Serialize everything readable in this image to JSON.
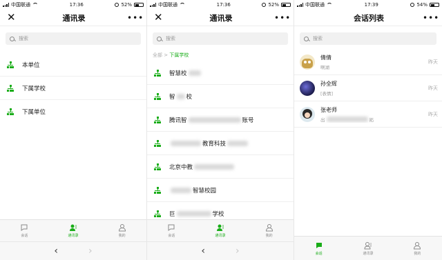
{
  "colors": {
    "accent": "#1aad19"
  },
  "screens": [
    {
      "status": {
        "carrier": "中国联通",
        "time": "17:36",
        "battery": "52%"
      },
      "nav": {
        "title": "通讯录",
        "close_icon": "close-icon",
        "more": "•••"
      },
      "search": {
        "placeholder": "搜索"
      },
      "orgs": [
        {
          "label": "本单位"
        },
        {
          "label": "下属学校"
        },
        {
          "label": "下属单位"
        }
      ],
      "tabs": [
        {
          "label": "会话"
        },
        {
          "label": "通讯录"
        },
        {
          "label": "我的"
        }
      ]
    },
    {
      "status": {
        "carrier": "中国联通",
        "time": "17:36",
        "battery": "52%"
      },
      "nav": {
        "title": "通讯录",
        "more": "•••"
      },
      "search": {
        "placeholder": "搜索"
      },
      "breadcrumb": {
        "root": "全部",
        "sep": ">",
        "current": "下属学校"
      },
      "orgs": [
        {
          "pre": "智慧校",
          "post": ""
        },
        {
          "pre": "智",
          "post": "校"
        },
        {
          "pre": "腾讯智",
          "post": "账号"
        },
        {
          "pre": "",
          "post": "教育科技"
        },
        {
          "pre": "北京中教",
          "post": ""
        },
        {
          "pre": "",
          "post": "智慧校园"
        },
        {
          "pre": "巨",
          "post": "学校"
        }
      ],
      "tabs": [
        {
          "label": "会话"
        },
        {
          "label": "通讯录"
        },
        {
          "label": "我的"
        }
      ]
    },
    {
      "status": {
        "carrier": "中国联通",
        "time": "17:39",
        "battery": "54%"
      },
      "nav": {
        "title": "会话列表",
        "more": "•••"
      },
      "search": {
        "placeholder": "搜索"
      },
      "chats": [
        {
          "name": "倩倩",
          "message": "啊湖",
          "time": "昨天"
        },
        {
          "name": "孙全辉",
          "message": "[表情]",
          "time": "昨天"
        },
        {
          "name": "张老师",
          "message": "出",
          "message_tail": "拓",
          "time": "昨天"
        }
      ],
      "tabs": [
        {
          "label": "会话"
        },
        {
          "label": "通讯录"
        },
        {
          "label": "我的"
        }
      ]
    }
  ]
}
